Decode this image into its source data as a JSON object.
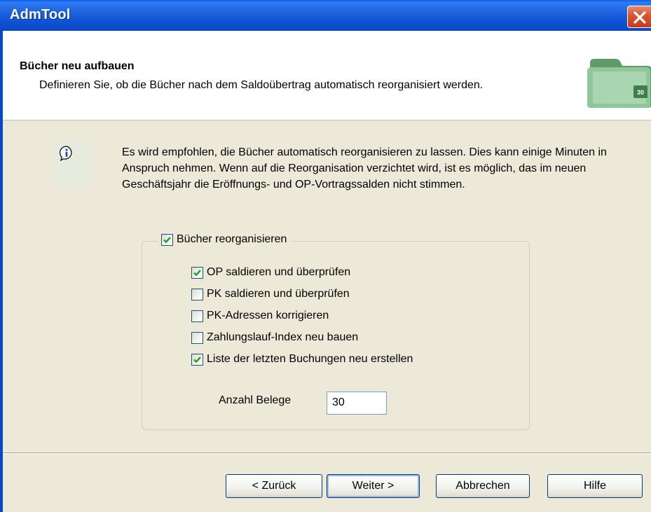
{
  "window": {
    "title": "AdmTool"
  },
  "header": {
    "title": "Bücher neu aufbauen",
    "description": "Definieren Sie, ob die Bücher nach dem Saldoübertrag automatisch reorganisiert werden.",
    "icon_badge": "30"
  },
  "info": {
    "text": "Es wird empfohlen, die Bücher automatisch reorganisieren zu lassen. Dies kann einige Minuten in Anspruch nehmen. Wenn auf die Reorganisation verzichtet wird, ist es möglich, das im neuen Geschäftsjahr die Eröffnungs- und OP-Vortragssalden nicht stimmen."
  },
  "group": {
    "label": "Bücher reorganisieren",
    "checked": true,
    "options": [
      {
        "label": "OP saldieren und überprüfen",
        "checked": true
      },
      {
        "label": "PK saldieren und überprüfen",
        "checked": false
      },
      {
        "label": "PK-Adressen korrigieren",
        "checked": false
      },
      {
        "label": "Zahlungslauf-Index neu bauen",
        "checked": false
      },
      {
        "label": "Liste der letzten Buchungen neu erstellen",
        "checked": true
      }
    ],
    "anzahl_label": "Anzahl Belege",
    "anzahl_value": "30"
  },
  "buttons": {
    "back": "< Zurück",
    "next": "Weiter >",
    "cancel": "Abbrechen",
    "help": "Hilfe"
  },
  "colors": {
    "titlebar": "#0A5FE6",
    "dialog_bg": "#ECE9D8",
    "check_green": "#21A121",
    "close_red": "#D9542F"
  }
}
